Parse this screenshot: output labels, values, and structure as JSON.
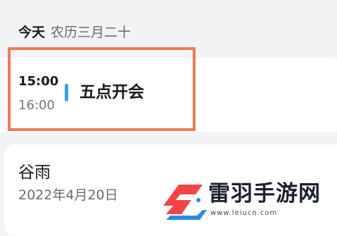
{
  "header": {
    "day": "今天",
    "lunar": "农历三月二十"
  },
  "event": {
    "start": "15:00",
    "end": "16:00",
    "title": "五点开会",
    "accent": "#3ba0e6",
    "highlight": "#ee7a53"
  },
  "holiday": {
    "name": "谷雨",
    "date": "2022年4月20日"
  },
  "watermark": {
    "name": "雷羽手游网",
    "url": "www.leiucn.com",
    "logo": "leiyu-logo"
  }
}
